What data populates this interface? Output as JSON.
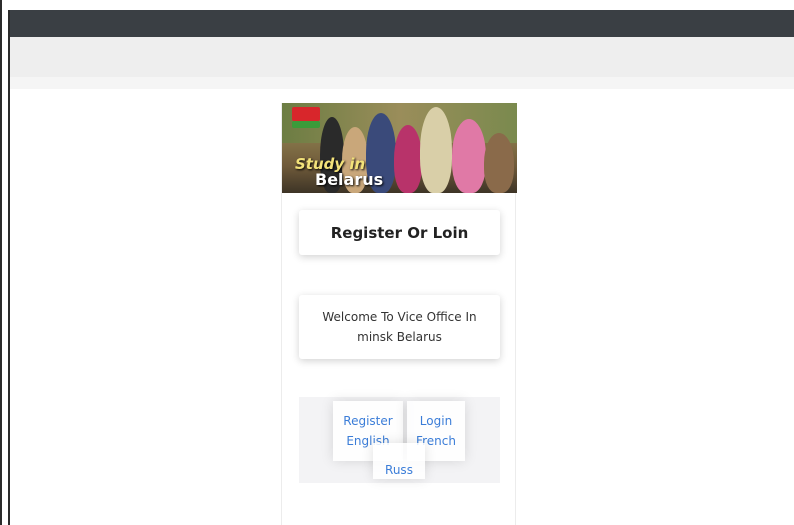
{
  "banner": {
    "text_line1": "Study in",
    "text_line2": "Belarus",
    "colors": {
      "flag_red": "#d8262b",
      "flag_green": "#3b9b3a"
    }
  },
  "title_box": {
    "label": "Register Or Loin"
  },
  "welcome_box": {
    "text": "Welcome To Vice Office In minsk Belarus"
  },
  "links": {
    "register": "Register",
    "login": "Login",
    "english": "English",
    "french": "French",
    "russ": "Russ"
  },
  "colors": {
    "link": "#3b7dd8",
    "topbar": "#3a3f44",
    "toolbar": "#eeeeee"
  }
}
